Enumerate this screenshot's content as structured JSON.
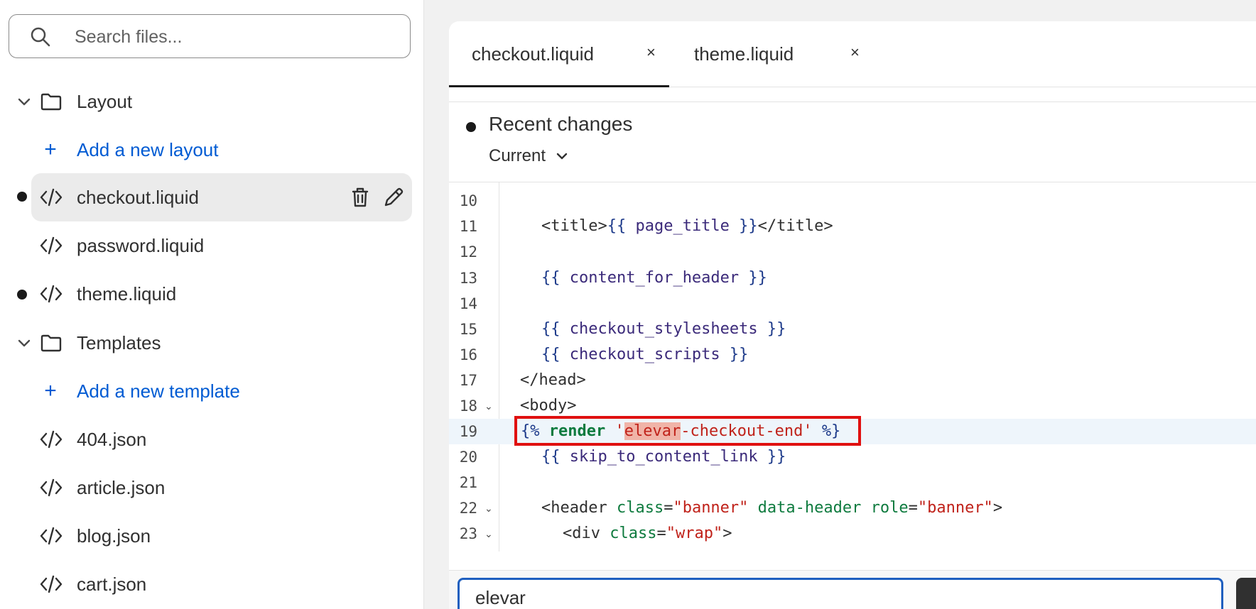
{
  "sidebar": {
    "search": {
      "placeholder": "Search files..."
    },
    "layout_folder": {
      "label": "Layout",
      "icon": "folder-icon"
    },
    "add_layout": {
      "label": "Add a new layout"
    },
    "layout_files": [
      {
        "label": "checkout.liquid",
        "modified": true,
        "active": true
      },
      {
        "label": "password.liquid",
        "modified": false,
        "active": false
      },
      {
        "label": "theme.liquid",
        "modified": true,
        "active": false
      }
    ],
    "templates_folder": {
      "label": "Templates",
      "icon": "folder-icon"
    },
    "add_template": {
      "label": "Add a new template"
    },
    "template_files": [
      {
        "label": "404.json"
      },
      {
        "label": "article.json"
      },
      {
        "label": "blog.json"
      },
      {
        "label": "cart.json"
      }
    ]
  },
  "tabs": [
    {
      "label": "checkout.liquid",
      "close": "×",
      "active": true
    },
    {
      "label": "theme.liquid",
      "close": "×",
      "active": false
    }
  ],
  "changes": {
    "title": "Recent changes",
    "selected": "Current"
  },
  "code": {
    "active_line": 19,
    "lines": [
      {
        "n": "10",
        "text": ""
      },
      {
        "n": "11",
        "text": "<title>{{ page_title }}</title>"
      },
      {
        "n": "12",
        "text": ""
      },
      {
        "n": "13",
        "text": "{{ content_for_header }}"
      },
      {
        "n": "14",
        "text": ""
      },
      {
        "n": "15",
        "text": "{{ checkout_stylesheets }}"
      },
      {
        "n": "16",
        "text": "{{ checkout_scripts }}"
      },
      {
        "n": "17",
        "text": "</head>"
      },
      {
        "n": "18",
        "text": "<body>"
      },
      {
        "n": "19",
        "text": "{% render 'elevar-checkout-end' %}"
      },
      {
        "n": "20",
        "text": "{{ skip_to_content_link }}"
      },
      {
        "n": "21",
        "text": ""
      },
      {
        "n": "22",
        "text": "<header class=\"banner\" data-header role=\"banner\">"
      },
      {
        "n": "23",
        "text": "<div class=\"wrap\">"
      }
    ]
  },
  "find": {
    "value": "elevar"
  },
  "colors": {
    "link": "#005bd3",
    "highlight_border": "#e01010",
    "find_border": "#1f5fbf"
  }
}
